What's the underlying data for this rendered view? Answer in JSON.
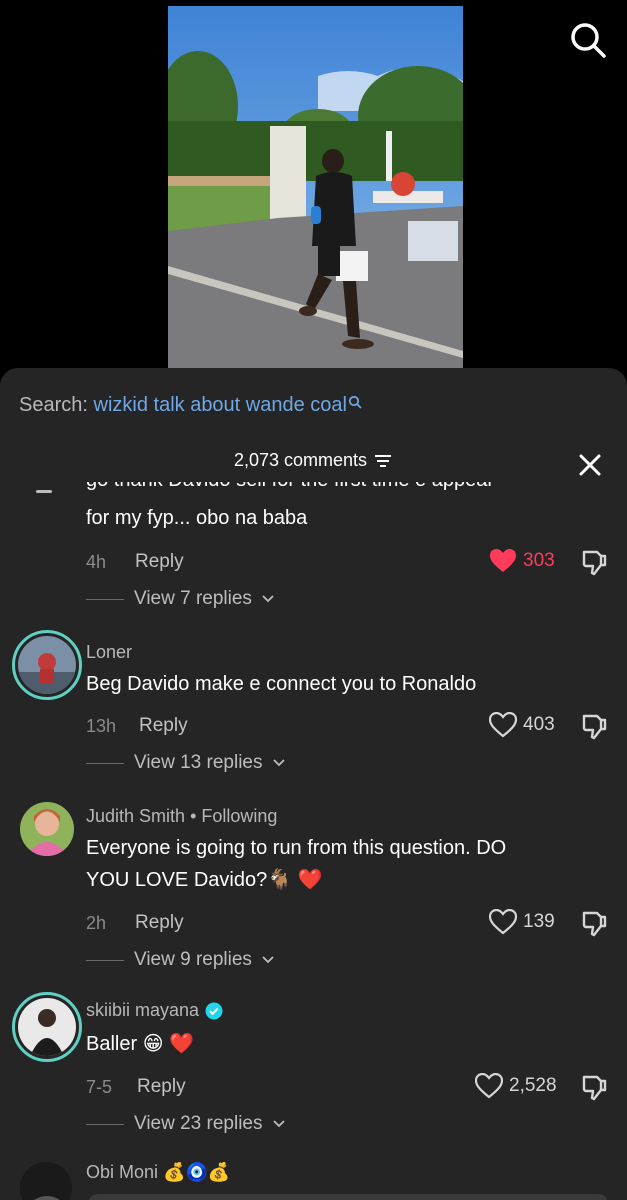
{
  "search": {
    "prefix": "Search:",
    "query": "wizkid talk about wande coal"
  },
  "header": {
    "count": "2,073 comments"
  },
  "comments": [
    {
      "text_cut": "go thank Davido sell for the first time e appear",
      "text": "for my fyp... obo na baba",
      "time": "4h",
      "reply_label": "Reply",
      "likes": "303",
      "liked": true,
      "view_replies": "View 7 replies"
    },
    {
      "name": "Loner",
      "text": "Beg Davido make e connect you to Ronaldo",
      "time": "13h",
      "reply_label": "Reply",
      "likes": "403",
      "view_replies": "View 13 replies"
    },
    {
      "name": "Judith Smith",
      "following": "• Following",
      "text_line1": "Everyone is going to run from this question. DO",
      "text_line2": "YOU LOVE Davido?",
      "emoji": "🐐 ❤️",
      "time": "2h",
      "reply_label": "Reply",
      "likes": "139",
      "view_replies": "View 9 replies"
    },
    {
      "name": "skiibii mayana",
      "verified": true,
      "text": "Baller",
      "emoji": "😁 ❤️",
      "time": "7-5",
      "reply_label": "Reply",
      "likes": "2,528",
      "view_replies": "View 23 replies"
    },
    {
      "name": "Obi Moni",
      "emoji": "💰🧿💰"
    }
  ],
  "colors": {
    "sheet_bg": "#252525",
    "query_blue": "#6ea8e6",
    "like_red": "#ff3b5c",
    "avatar_ring": "#5fd0c2",
    "verified_blue": "#20d5ec"
  },
  "icons": [
    "search-icon",
    "filter-icon",
    "close-icon",
    "heart-icon",
    "dislike-icon",
    "chevron-down-icon",
    "verified-icon"
  ]
}
